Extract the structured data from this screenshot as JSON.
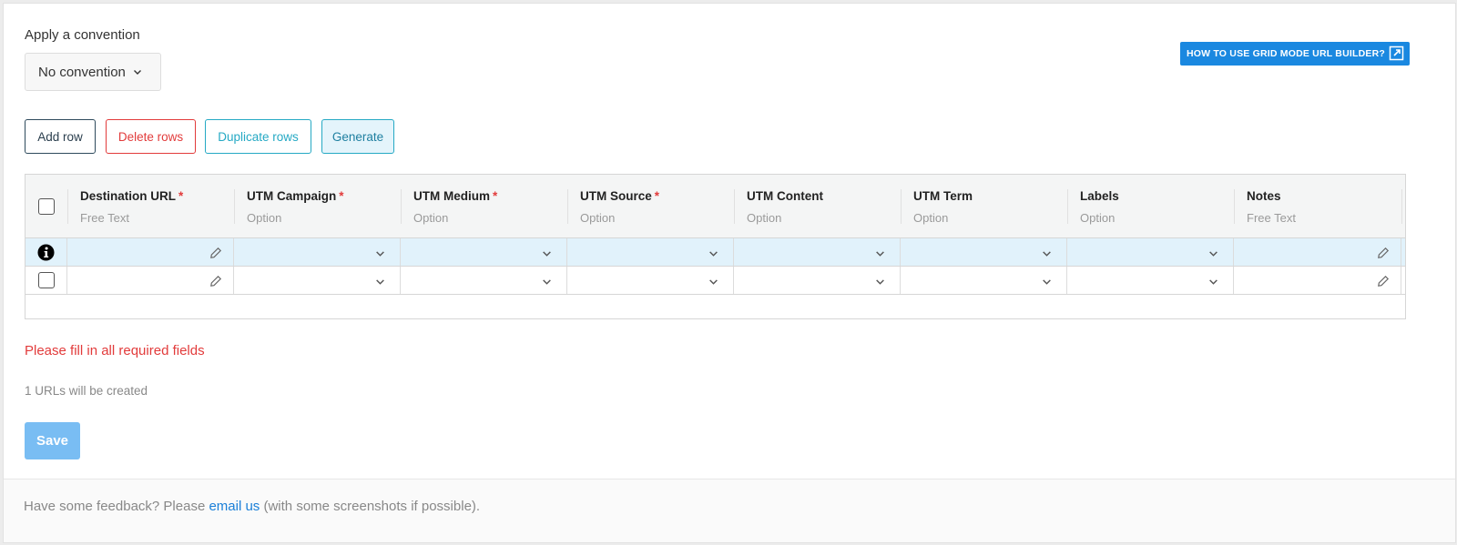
{
  "convention": {
    "label": "Apply a convention",
    "selected": "No convention"
  },
  "help_button": {
    "label": "HOW TO USE GRID MODE URL BUILDER?"
  },
  "toolbar": {
    "add_row": "Add row",
    "delete_rows": "Delete rows",
    "duplicate_rows": "Duplicate rows",
    "generate": "Generate"
  },
  "grid": {
    "columns": [
      {
        "title": "Destination URL",
        "required": "*",
        "subtitle": "Free Text",
        "editor": "pencil-icon"
      },
      {
        "title": "UTM Campaign",
        "required": "*",
        "subtitle": "Option",
        "editor": "chevron-down-icon"
      },
      {
        "title": "UTM Medium",
        "required": "*",
        "subtitle": "Option",
        "editor": "chevron-down-icon"
      },
      {
        "title": "UTM Source",
        "required": "*",
        "subtitle": "Option",
        "editor": "chevron-down-icon"
      },
      {
        "title": "UTM Content",
        "required": "",
        "subtitle": "Option",
        "editor": "chevron-down-icon"
      },
      {
        "title": "UTM Term",
        "required": "",
        "subtitle": "Option",
        "editor": "chevron-down-icon"
      },
      {
        "title": "Labels",
        "required": "",
        "subtitle": "Option",
        "editor": "chevron-down-icon"
      },
      {
        "title": "Notes",
        "required": "",
        "subtitle": "Free Text",
        "editor": "pencil-icon"
      }
    ],
    "rows": [
      {
        "marker": "info-icon",
        "highlighted": true
      },
      {
        "marker": "checkbox",
        "highlighted": false
      }
    ]
  },
  "status": {
    "error": "Please fill in all required fields",
    "count": "1 URLs will be created"
  },
  "save_label": "Save",
  "footer": {
    "before": "Have some feedback? Please ",
    "link": "email us",
    "after": " (with some screenshots if possible)."
  },
  "colors": {
    "primary": "#1a88e0",
    "danger": "#e23b3b",
    "accent": "#25a9c4",
    "row_highlight": "#e1f2fb",
    "save_disabled": "#79bdf3"
  }
}
